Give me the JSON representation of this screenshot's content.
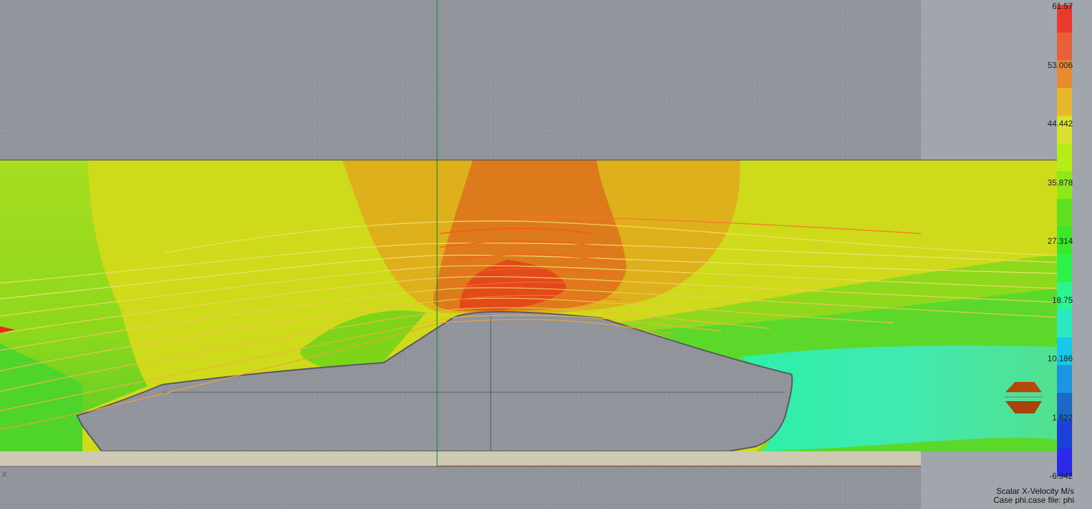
{
  "colorbar": {
    "labels": [
      "61.57",
      "53.006",
      "44.442",
      "35.878",
      "27.314",
      "18.75",
      "10.186",
      "1.622",
      "-6.942"
    ],
    "colors": [
      "#e83b2e",
      "#e8603a",
      "#e88a30",
      "#e6b830",
      "#d8e030",
      "#b6ec1a",
      "#8ee818",
      "#5fe020",
      "#3ce628",
      "#2cf24a",
      "#2cf490",
      "#2ce8c0",
      "#18c8e8",
      "#1a96e0",
      "#1a68c8",
      "#1a40d8",
      "#2a2ae8"
    ]
  },
  "caption": {
    "line1": "Scalar X-Velocity M/s",
    "line2": "Case phi.case file: phi"
  },
  "axis_letter": "X"
}
